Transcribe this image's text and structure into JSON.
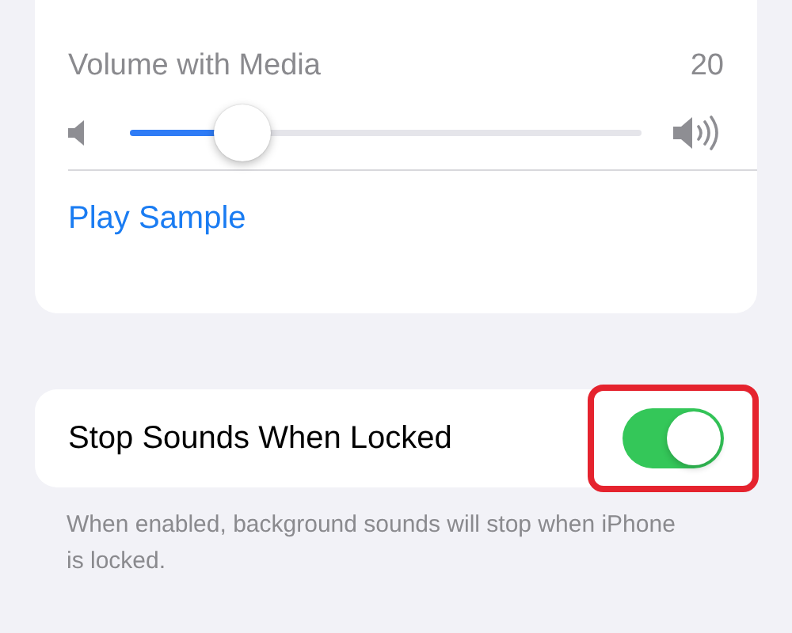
{
  "volume": {
    "label": "Volume with Media",
    "value": "20",
    "level": 0.22
  },
  "play_sample": {
    "label": "Play Sample"
  },
  "stop_sounds": {
    "label": "Stop Sounds When Locked",
    "on": true,
    "highlighted": true
  },
  "footnote": "When enabled, background sounds will stop when iPhone is locked."
}
